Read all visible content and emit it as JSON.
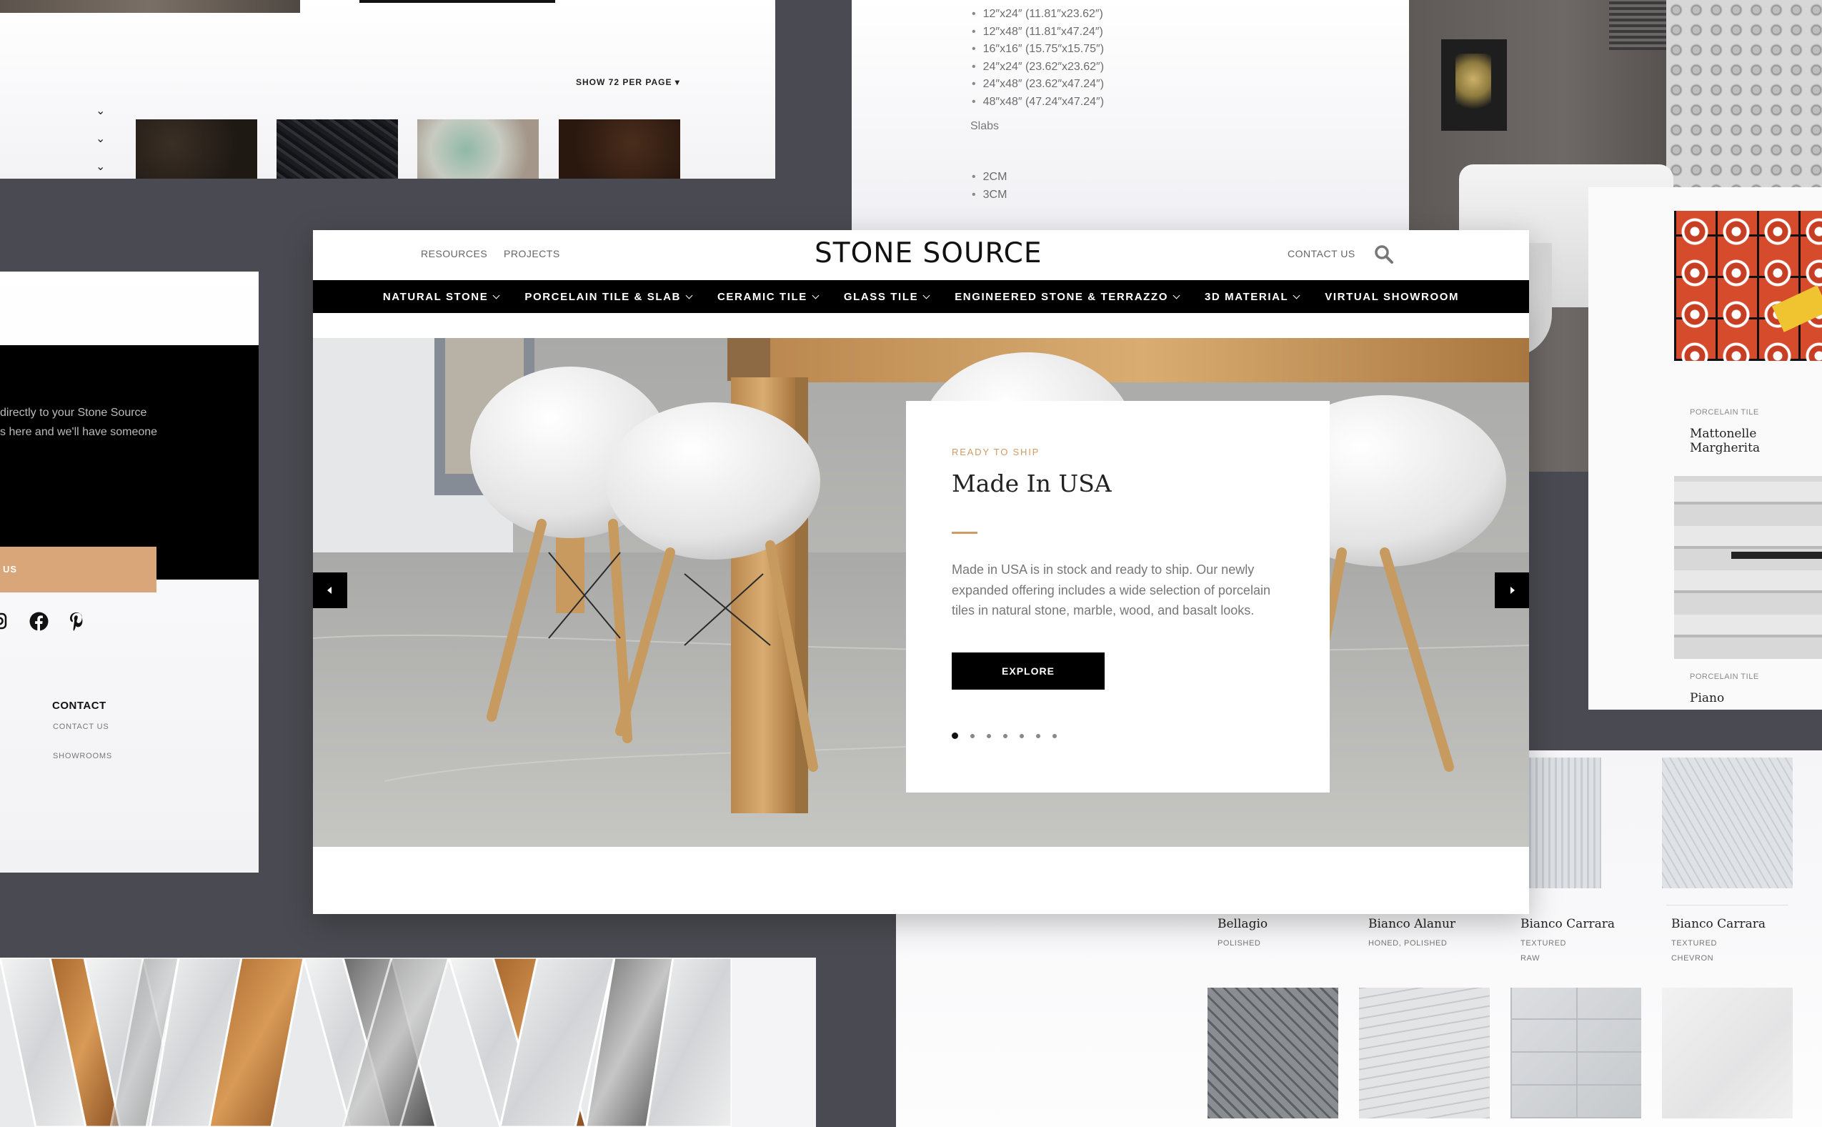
{
  "top_left": {
    "show_per_page": "SHOW 72 PER PAGE ▾"
  },
  "specs": {
    "sizes": [
      "12″x24″ (11.81″x23.62″)",
      "12″x48″ (11.81″x47.24″)",
      "16″x16″ (15.75″x15.75″)",
      "24″x24″ (23.62″x23.62″)",
      "24″x48″ (23.62″x47.24″)",
      "48″x48″ (47.24″x47.24″)"
    ],
    "slabs_label": "Slabs",
    "thicknesses": [
      "2CM",
      "3CM"
    ]
  },
  "right_panel": {
    "products": [
      {
        "category": "PORCELAIN TILE",
        "name": "Mattonelle Margherita"
      },
      {
        "category": "PORCELAIN TILE",
        "name": "Piano"
      }
    ]
  },
  "left_panel": {
    "text_line1": "directly to your Stone Source",
    "text_line2": "s here and we'll have someone",
    "cta_label": "US",
    "contact_heading": "CONTACT",
    "links": [
      "CONTACT US",
      "SHOWROOMS"
    ]
  },
  "grid": {
    "products": [
      {
        "name": "Bellagio",
        "finish": "POLISHED",
        "finish2": ""
      },
      {
        "name": "Bianco Alanur",
        "finish": "HONED, POLISHED",
        "finish2": ""
      },
      {
        "name": "Bianco Carrara",
        "finish": "TEXTURED",
        "finish2": "RAW"
      },
      {
        "name": "Bianco Carrara",
        "finish": "TEXTURED",
        "finish2": "CHEVRON"
      }
    ]
  },
  "header": {
    "resources": "RESOURCES",
    "projects": "PROJECTS",
    "logo": "STONE SOURCE",
    "contact": "CONTACT US"
  },
  "nav": [
    {
      "label": "NATURAL STONE",
      "caret": true
    },
    {
      "label": "PORCELAIN TILE & SLAB",
      "caret": true
    },
    {
      "label": "CERAMIC TILE",
      "caret": true
    },
    {
      "label": "GLASS TILE",
      "caret": true
    },
    {
      "label": "ENGINEERED STONE & TERRAZZO",
      "caret": true
    },
    {
      "label": "3D MATERIAL",
      "caret": true
    },
    {
      "label": "VIRTUAL SHOWROOM",
      "caret": false
    }
  ],
  "hero": {
    "kicker": "READY TO SHIP",
    "title": "Made In USA",
    "body": "Made in USA is in stock and ready to ship. Our newly expanded offering includes a wide selection of porcelain tiles in natural stone, marble, wood, and basalt looks.",
    "button": "EXPLORE",
    "slide_count": 7,
    "active_slide": 1
  },
  "colors": {
    "accent": "#d09a63",
    "cta_fill": "#d8a678",
    "background": "#4a4b52"
  }
}
